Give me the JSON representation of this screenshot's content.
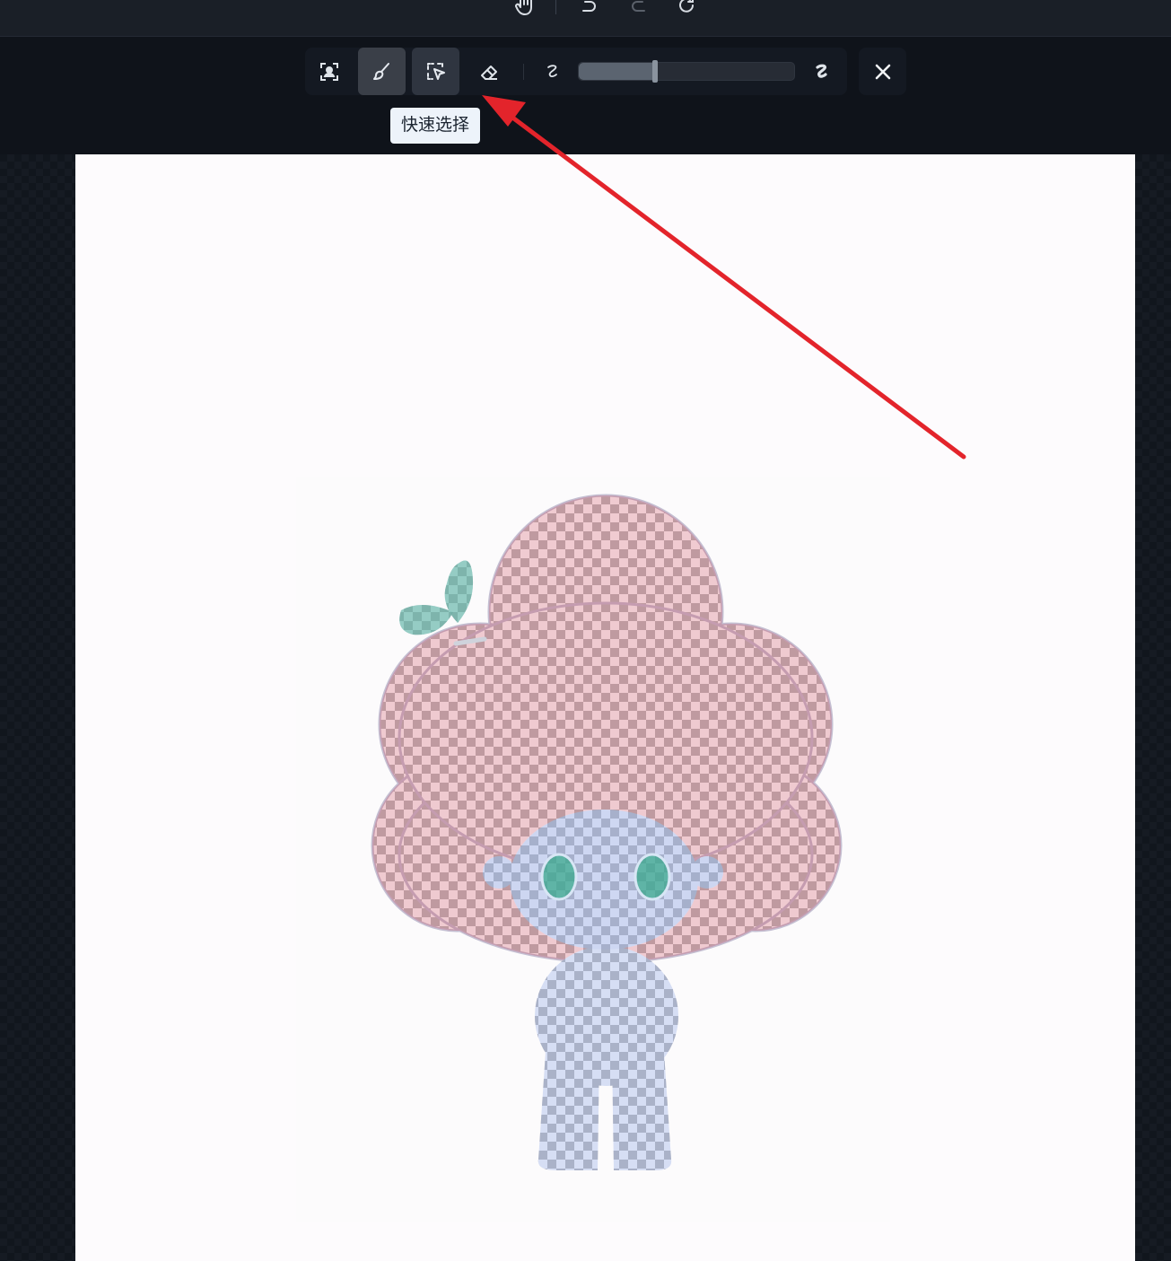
{
  "top_toolbar": {
    "icons": [
      "hand-icon",
      "undo-icon",
      "redo-icon",
      "refresh-icon"
    ]
  },
  "mask_toolbar": {
    "tools": [
      {
        "name": "portrait-select-icon",
        "active": false
      },
      {
        "name": "brush-icon",
        "active": true
      },
      {
        "name": "quick-select-icon",
        "active": true
      },
      {
        "name": "eraser-icon",
        "active": false
      }
    ],
    "brush_size": {
      "min_icon": "thin-stroke-icon",
      "max_icon": "thick-stroke-icon",
      "value_percent": 35
    },
    "close_icon": "close-icon"
  },
  "tooltip": {
    "text": "快速选择"
  },
  "colors": {
    "app_bg": "#0f131a",
    "toolbar_bg": "#141922",
    "tooltip_bg": "#edf3fa",
    "annotation_arrow": "#e3242b",
    "mask_overlay": "#8aa0e0"
  }
}
